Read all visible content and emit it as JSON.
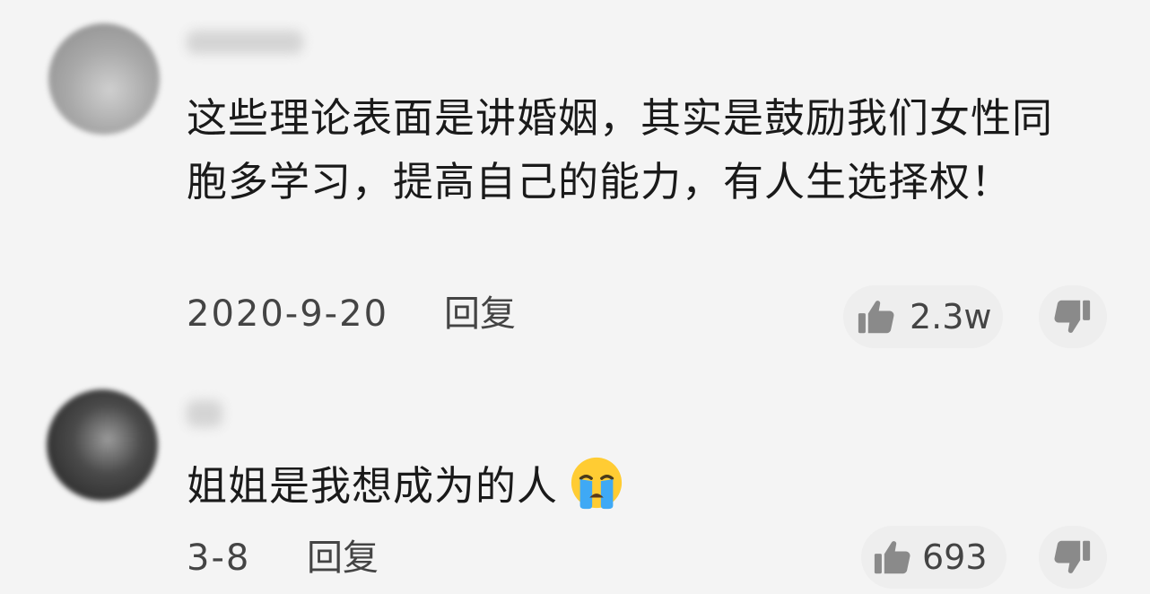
{
  "comments": [
    {
      "text": "这些理论表面是讲婚姻，其实是鼓励我们女性同胞多学习，提高自己的能力，有人生选择权！",
      "date": "2020-9-20",
      "reply_label": "回复",
      "like_count": "2.3w"
    },
    {
      "text": "姐姐是我想成为的人",
      "emoji": "crying-face-emoji",
      "date": "3-8",
      "reply_label": "回复",
      "like_count": "693"
    }
  ]
}
